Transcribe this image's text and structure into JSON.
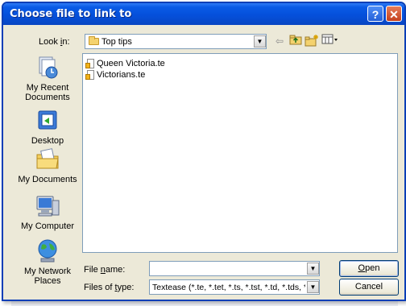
{
  "window": {
    "title": "Choose file to link to"
  },
  "titlebar": {
    "help_glyph": "?",
    "close_glyph": "✕"
  },
  "lookin": {
    "label": "Look in:",
    "value": "Top tips"
  },
  "places": [
    {
      "label": "My Recent Documents",
      "icon": "recent-documents-icon"
    },
    {
      "label": "Desktop",
      "icon": "desktop-icon"
    },
    {
      "label": "My Documents",
      "icon": "my-documents-icon"
    },
    {
      "label": "My Computer",
      "icon": "my-computer-icon"
    },
    {
      "label": "My Network Places",
      "icon": "network-places-icon"
    }
  ],
  "files": [
    {
      "name": "Queen Victoria.te"
    },
    {
      "name": "Victorians.te"
    }
  ],
  "filename": {
    "label_pre": "File ",
    "label_u": "n",
    "label_post": "ame:",
    "value": ""
  },
  "filetype": {
    "label_pre": "Files of ",
    "label_u": "t",
    "label_post": "ype:",
    "value": "Textease (*.te, *.tet, *.ts, *.tst, *.td, *.tds, *.tp, *.t"
  },
  "buttons": {
    "open_u": "O",
    "open_rest": "pen",
    "cancel": "Cancel"
  },
  "colors": {
    "titlebar": "#0550db",
    "dialog": "#ece9d8",
    "border": "#7f9db9"
  }
}
